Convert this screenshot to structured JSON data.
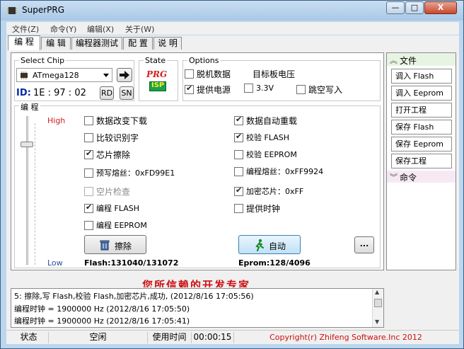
{
  "window": {
    "title": "SuperPRG",
    "minimize": "—",
    "maximize": "□",
    "close": "X"
  },
  "menu": [
    "文件(Z)",
    "命令(Y)",
    "编辑(X)",
    "关于(W)"
  ],
  "tabs": [
    "编 程",
    "编 辑",
    "编程器测试",
    "配 置",
    "说 明"
  ],
  "select_chip": {
    "label": "Select Chip",
    "chip": "ATmega128",
    "id_label": "ID:",
    "id_value": "1E : 97 : 02",
    "rd": "RD",
    "sn": "SN"
  },
  "state": {
    "label": "State",
    "logo_top": "PRG",
    "logo_bottom": "ISP"
  },
  "options": {
    "label": "Options",
    "offline": "脱机数据",
    "target_voltage": "目标板电压",
    "power": "提供电源",
    "v33": "3.3V",
    "skip_empty": "跳空写入"
  },
  "program": {
    "label": "编 程",
    "high": "High",
    "low": "Low",
    "left_options": [
      {
        "text": "数据改变下载",
        "checked": false,
        "disabled": false
      },
      {
        "text": "比较识别字",
        "checked": false,
        "disabled": false
      },
      {
        "text": "芯片擦除",
        "checked": true,
        "disabled": false
      },
      {
        "text": "预写熔丝：0xFD99E1",
        "checked": false,
        "disabled": false
      },
      {
        "text": "空片检查",
        "checked": false,
        "disabled": true
      },
      {
        "text": "编程 FLASH",
        "checked": true,
        "disabled": false
      },
      {
        "text": "编程 EEPROM",
        "checked": false,
        "disabled": false
      }
    ],
    "right_options": [
      {
        "text": "数据自动重载",
        "checked": true
      },
      {
        "text": "校验 FLASH",
        "checked": true
      },
      {
        "text": "校验 EEPROM",
        "checked": false
      },
      {
        "text": "编程熔丝：0xFF9924",
        "checked": false
      },
      {
        "text": "加密芯片：0xFF",
        "checked": true
      },
      {
        "text": "提供时钟",
        "checked": false
      }
    ],
    "erase_button": "擦除",
    "auto_button": "自动",
    "more_button": "...",
    "flash_info": "Flash:131040/131072",
    "eprom_info": "Eprom:128/4096"
  },
  "slogan": "您所信赖的开发专家",
  "sidebar": {
    "file_header": "文件",
    "buttons": [
      "调入 Flash",
      "调入 Eeprom",
      "打开工程",
      "保存 Flash",
      "保存 Eeprom",
      "保存工程"
    ],
    "command_header": "命令"
  },
  "log": [
    "5: 擦除,写 Flash,校验 Flash,加密芯片,成功, (2012/8/16 17:05:56)",
    "编程时钟 = 1900000 Hz (2012/8/16 17:05:50)",
    "编程时钟 = 1900000 Hz (2012/8/16 17:05:41)"
  ],
  "status": {
    "state_label": "状态",
    "state_value": "空闲",
    "time_label": "使用时间",
    "time_value": "00:00:15",
    "copyright": "Copyright(r) Zhifeng Software.Inc 2012"
  },
  "colors": {
    "accent_red": "#d21f1f",
    "id_blue": "#0a2aa8",
    "slogan_red": "#cc1010"
  }
}
